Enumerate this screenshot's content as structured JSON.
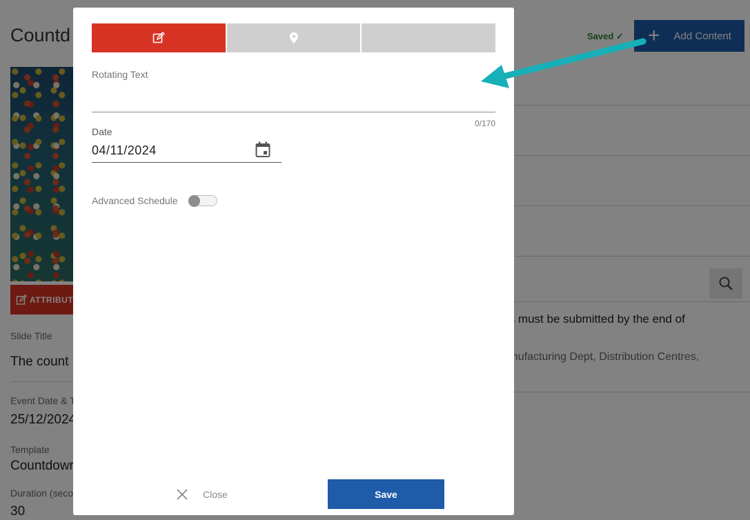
{
  "background": {
    "page_title": "Countd",
    "saved_label": "Saved ✓",
    "add_content_label": "Add Content",
    "attributes_button_label": "ATTRIBUT",
    "slide_title_label": "Slide Title",
    "slide_title_value": "The count",
    "event_date_label": "Event Date & T",
    "event_date_value": "25/12/2024",
    "template_label": "Template",
    "template_value": "Countdowr",
    "duration_label": "Duration (seco",
    "duration_value": "30",
    "description_text": "ts must be submitted by the end of",
    "audience_text": "anufacturing Dept, Distribution Centres,"
  },
  "modal": {
    "tabs": [
      {
        "icon": "edit-icon",
        "active": true
      },
      {
        "icon": "location-pin-icon",
        "active": false
      },
      {
        "icon": "",
        "active": false
      }
    ],
    "rotating_text_label": "Rotating Text",
    "rotating_text_value": "",
    "rotating_text_counter": "0/170",
    "date_label": "Date",
    "date_value": "04/11/2024",
    "advanced_schedule_label": "Advanced Schedule",
    "advanced_schedule_enabled": false,
    "close_label": "Close",
    "save_label": "Save"
  },
  "colors": {
    "accent_red": "#d73325",
    "primary_blue": "#1e5ba8",
    "annotation_arrow": "#17b0b8",
    "saved_green": "#2e7d32"
  }
}
